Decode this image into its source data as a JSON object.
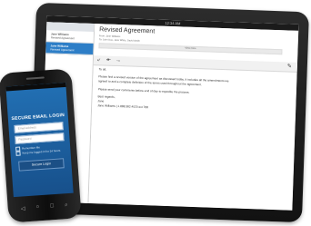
{
  "tablet": {
    "status_time": "12:34 AM",
    "sidebar": {
      "header": "",
      "items": [
        {
          "who": "Jane Williams",
          "subject": "Revised Agreement",
          "selected": false
        },
        {
          "who": "Jane Williams",
          "subject": "Revised Agreement",
          "selected": true
        }
      ]
    },
    "email": {
      "title": "Revised Agreement",
      "from": "From: Jane Williams",
      "to": "To: John Doe, Jane White, David Smith",
      "view_more": "View more"
    },
    "body": {
      "greeting": "To all,",
      "p1": "Please find a revised version of the agreement as discussed today. It includes all the amendments we",
      "p1b": "agreed to and a complete definition of the terms used throughout the agreement.",
      "p2": "Please send your comments before end of day to expedite the process.",
      "closing": "Best regards,",
      "name": "Jane",
      "sig": "Jane Williams | 1.888.382.4520 ext 768"
    }
  },
  "phone": {
    "title": "SECURE EMAIL LOGIN",
    "username_placeholder": "Email address",
    "password_placeholder": "Password",
    "remember_label": "Remember Me",
    "keep_logged_label": "Keep me logged in for 24 hours",
    "login_button": "Secure Login",
    "keys": [
      "◁",
      "○",
      "□",
      "⌕"
    ]
  }
}
